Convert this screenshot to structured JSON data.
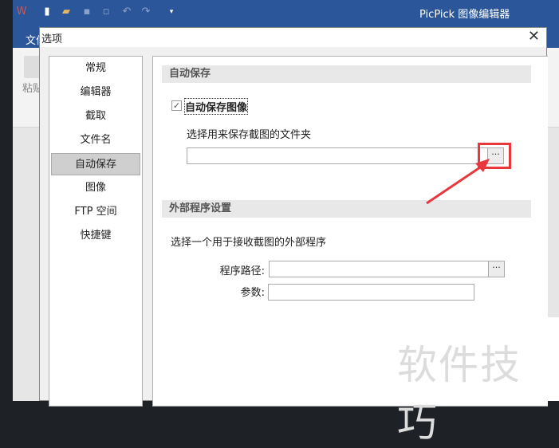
{
  "app": {
    "title": "PicPick 图像编辑器",
    "file_tab": "文件",
    "paste_label": "粘贴"
  },
  "dialog": {
    "title": "选项",
    "nav": [
      "常规",
      "编辑器",
      "截取",
      "文件名",
      "自动保存",
      "图像",
      "FTP 空间",
      "快捷键"
    ],
    "selected_nav": "自动保存",
    "autosave": {
      "header": "自动保存",
      "checkbox_label": "自动保存图像",
      "checked": true,
      "folder_label": "选择用来保存截图的文件夹",
      "folder_value": "",
      "browse": "···"
    },
    "external": {
      "header": "外部程序设置",
      "desc": "选择一个用于接收截图的外部程序",
      "path_label": "程序路径:",
      "path_value": "",
      "browse": "···",
      "args_label": "参数:",
      "args_value": ""
    }
  },
  "watermark": "软件技巧",
  "colors": {
    "titlebar": "#2b579a",
    "highlight": "#e8383d"
  }
}
